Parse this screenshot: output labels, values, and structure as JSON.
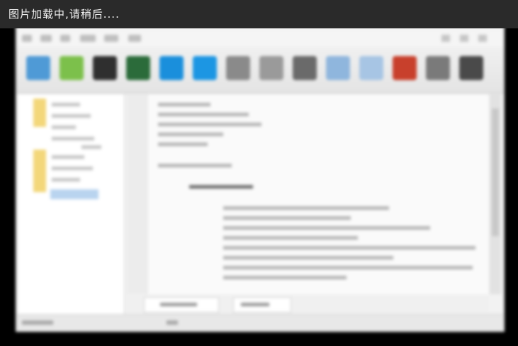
{
  "loading_text": "图片加载中,请稍后....",
  "toolbar": {
    "icons": [
      {
        "name": "file-icon",
        "color": "#4f9ad6"
      },
      {
        "name": "open-folder-icon",
        "color": "#7cc04b"
      },
      {
        "name": "save-icon",
        "color": "#2f2f2f"
      },
      {
        "name": "save-all-icon",
        "color": "#2b6b3a"
      },
      {
        "name": "cut-icon",
        "color": "#1a8fdc"
      },
      {
        "name": "copy-icon",
        "color": "#1c96e3"
      },
      {
        "name": "paste-icon",
        "color": "#8a8a8a"
      },
      {
        "name": "undo-icon",
        "color": "#9a9a9a"
      },
      {
        "name": "redo-icon",
        "color": "#6a6a6a"
      },
      {
        "name": "find-icon",
        "color": "#8fb6dd"
      },
      {
        "name": "replace-icon",
        "color": "#a7c5e4"
      },
      {
        "name": "build-icon",
        "color": "#c8402c"
      },
      {
        "name": "settings-icon",
        "color": "#7a7a7a"
      },
      {
        "name": "run-icon",
        "color": "#4a4a4a"
      }
    ]
  }
}
